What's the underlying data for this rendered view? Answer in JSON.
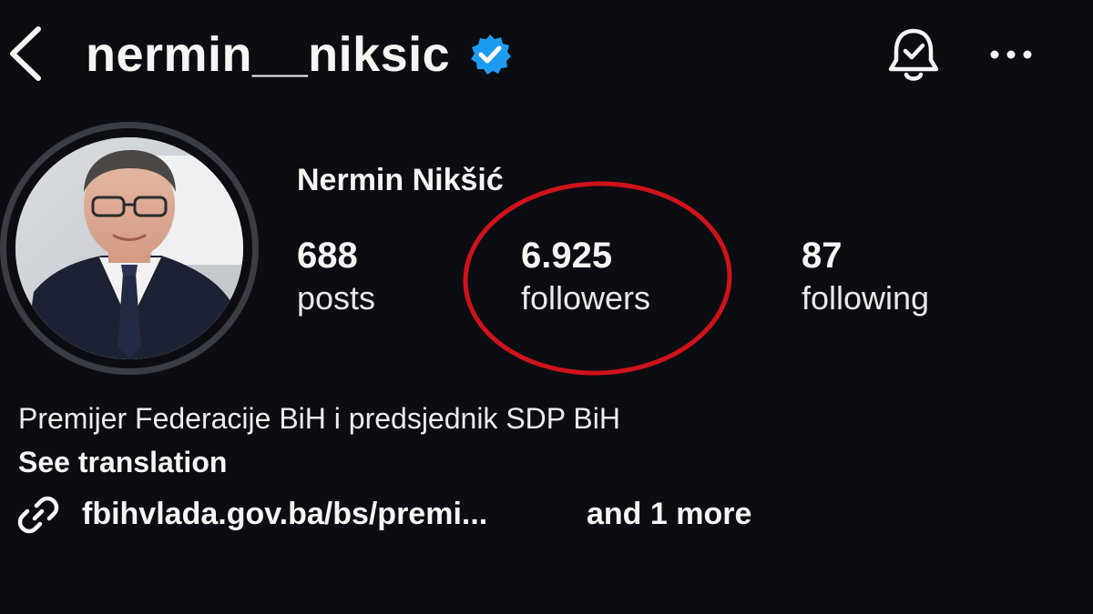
{
  "header": {
    "username": "nermin__niksic",
    "verified": true,
    "back_icon": "chevron-left-icon",
    "bell_icon": "notification-bell-check-icon",
    "more_icon": "ellipsis-icon"
  },
  "profile": {
    "display_name": "Nermin Nikšić",
    "avatar_icon": "profile-photo",
    "stats": [
      {
        "value": "688",
        "label": "posts"
      },
      {
        "value": "6.925",
        "label": "followers"
      },
      {
        "value": "87",
        "label": "following"
      }
    ],
    "bio": "Premijer Federacije BiH i predsjednik SDP BiH",
    "see_translation": "See translation",
    "link": {
      "icon": "link-icon",
      "text": "fbihvlada.gov.ba/bs/premi...",
      "more": "and 1 more"
    }
  },
  "colors": {
    "background": "#0b0d12",
    "text": "#f5f5f5",
    "verified_badge": "#1d9bf0",
    "annotation_circle": "#d0121b",
    "avatar_ring": "#3a3d44"
  }
}
